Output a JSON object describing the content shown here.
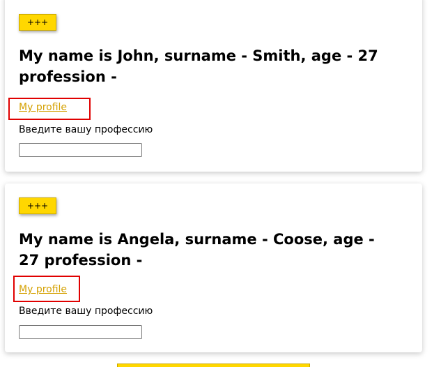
{
  "users": [
    {
      "button_label": "+++",
      "heading": "My name is John, surname - Smith, age - 27 profession -",
      "link_label": "My profile",
      "profession_label": "Введите вашу профессию",
      "profession_value": ""
    },
    {
      "button_label": "+++",
      "heading": "My name is Angela, surname - Coose, age - 27 profession -",
      "link_label": "My profile",
      "profession_label": "Введите вашу профессию",
      "profession_value": ""
    }
  ],
  "colors": {
    "button_bg": "#ffd700",
    "link": "#d4a000",
    "highlight_frame": "#e00000"
  }
}
